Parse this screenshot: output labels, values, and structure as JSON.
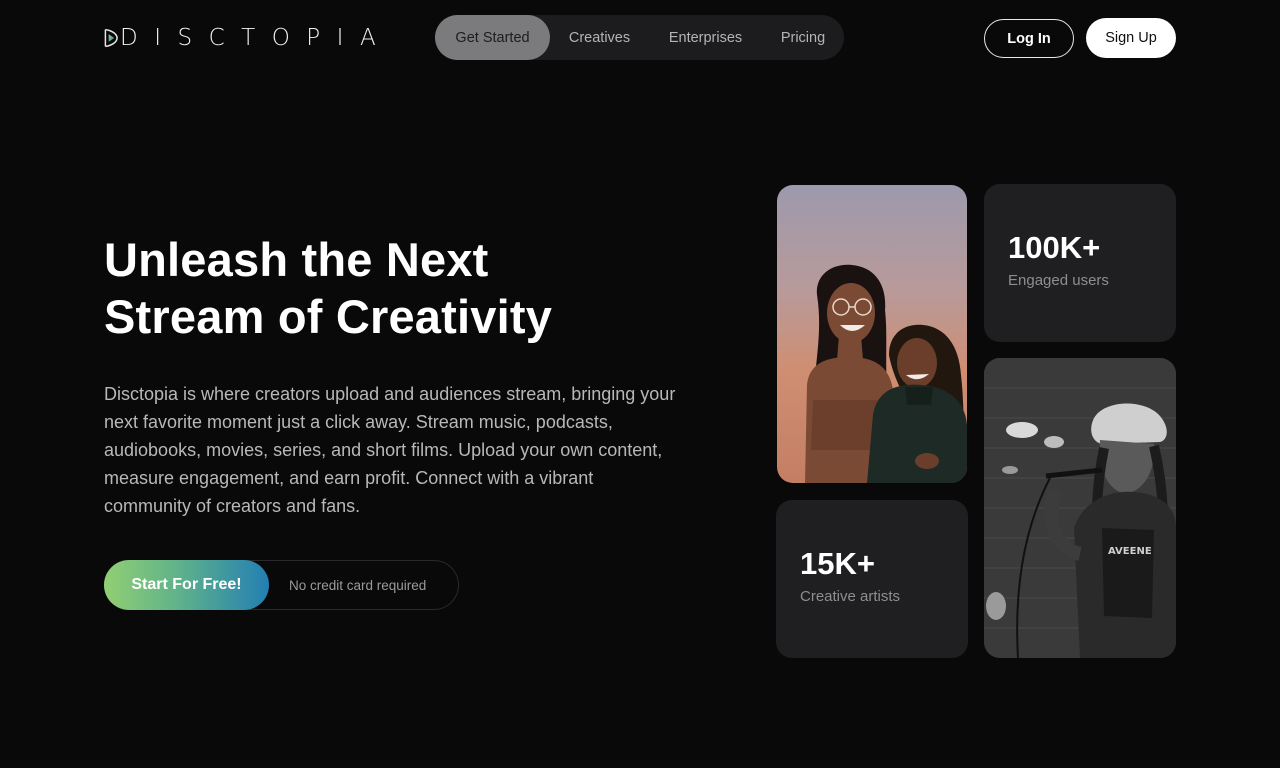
{
  "brand": {
    "name": "DISCTOPIA",
    "logo_icon": "play-triangle-icon"
  },
  "nav": {
    "items": [
      {
        "label": "Get Started",
        "active": true
      },
      {
        "label": "Creatives",
        "active": false
      },
      {
        "label": "Enterprises",
        "active": false
      },
      {
        "label": "Pricing",
        "active": false
      }
    ]
  },
  "auth": {
    "login_label": "Log In",
    "signup_label": "Sign Up"
  },
  "hero": {
    "title_line1": "Unleash the Next",
    "title_line2": "Stream of Creativity",
    "description": "Disctopia is where creators upload and audiences stream, bringing your next favorite moment just a click away. Stream music, podcasts, audiobooks, movies, series, and short films. Upload your own content, measure engagement, and earn profit. Connect with a vibrant community of creators and fans.",
    "cta_label": "Start For Free!",
    "cta_note": "No credit card required"
  },
  "stats": [
    {
      "value": "100K+",
      "label": "Engaged users"
    },
    {
      "value": "15K+",
      "label": "Creative artists"
    }
  ],
  "colors": {
    "background": "#09090a",
    "nav_bg": "#1c1c1e",
    "nav_active": "#7b7b7d",
    "card_bg": "#1f1f21",
    "cta_gradient_start": "#92cf73",
    "cta_gradient_end": "#237fb3"
  }
}
